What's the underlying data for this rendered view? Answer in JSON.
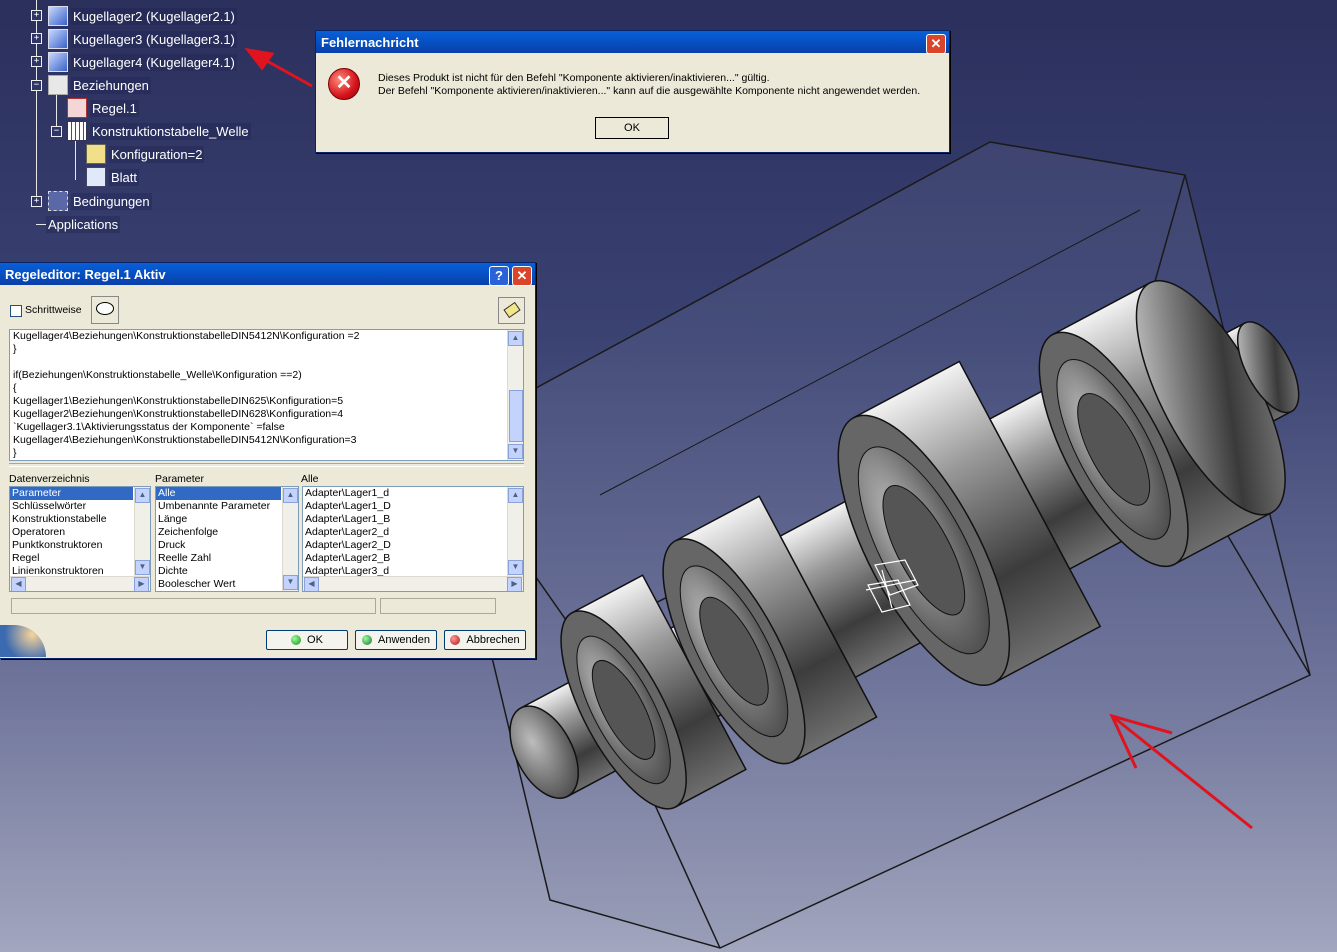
{
  "tree": {
    "items": [
      {
        "label": "Kugellager2 (Kugellager2.1)"
      },
      {
        "label": "Kugellager3 (Kugellager3.1)"
      },
      {
        "label": "Kugellager4 (Kugellager4.1)"
      },
      {
        "label": "Beziehungen"
      },
      {
        "label": "Regel.1"
      },
      {
        "label": "Konstruktionstabelle_Welle"
      },
      {
        "label": "Konfiguration=2"
      },
      {
        "label": "Blatt"
      },
      {
        "label": "Bedingungen"
      },
      {
        "label": "Applications"
      }
    ]
  },
  "error_dialog": {
    "title": "Fehlernachricht",
    "line1": "Dieses Produkt ist nicht für den Befehl \"Komponente aktivieren/inaktivieren...\" gültig.",
    "line2": "Der Befehl \"Komponente aktivieren/inaktivieren...\" kann auf die ausgewählte Komponente nicht angewendet werden.",
    "ok_label": "OK",
    "close_glyph": "✕"
  },
  "rule_editor": {
    "title": "Regeleditor: Regel.1 Aktiv",
    "help_glyph": "?",
    "close_glyph": "✕",
    "step_label": "Schrittweise",
    "code_lines": [
      "Kugellager4\\Beziehungen\\KonstruktionstabelleDIN5412N\\Konfiguration =2",
      "}",
      "",
      "if(Beziehungen\\Konstruktionstabelle_Welle\\Konfiguration ==2)",
      "{",
      "Kugellager1\\Beziehungen\\KonstruktionstabelleDIN625\\Konfiguration=5",
      "Kugellager2\\Beziehungen\\KonstruktionstabelleDIN628\\Konfiguration=4",
      "`Kugellager3.1\\Aktivierungsstatus der Komponente` =false",
      "Kugellager4\\Beziehungen\\KonstruktionstabelleDIN5412N\\Konfiguration=3",
      "}"
    ],
    "col1_label": "Datenverzeichnis",
    "col2_label": "Parameter",
    "col3_label": "Alle",
    "col1_items": [
      "Parameter",
      "Schlüsselwörter",
      "Konstruktionstabelle",
      "Operatoren",
      "Punktkonstruktoren",
      "Regel",
      "Linienkonstruktoren"
    ],
    "col2_items": [
      "Alle",
      "Umbenannte Parameter",
      "Länge",
      "Zeichenfolge",
      "Druck",
      "Reelle Zahl",
      "Dichte",
      "Boolescher Wert"
    ],
    "col3_items": [
      "Adapter\\Lager1_d",
      "Adapter\\Lager1_D",
      "Adapter\\Lager1_B",
      "Adapter\\Lager2_d",
      "Adapter\\Lager2_D",
      "Adapter\\Lager2_B",
      "Adapter\\Lager3_d"
    ],
    "ok_label": "OK",
    "apply_label": "Anwenden",
    "cancel_label": "Abbrechen"
  },
  "colors": {
    "arrow": "#e0141e",
    "titlebar": "#0a5fd8",
    "selection": "#316ac5"
  }
}
